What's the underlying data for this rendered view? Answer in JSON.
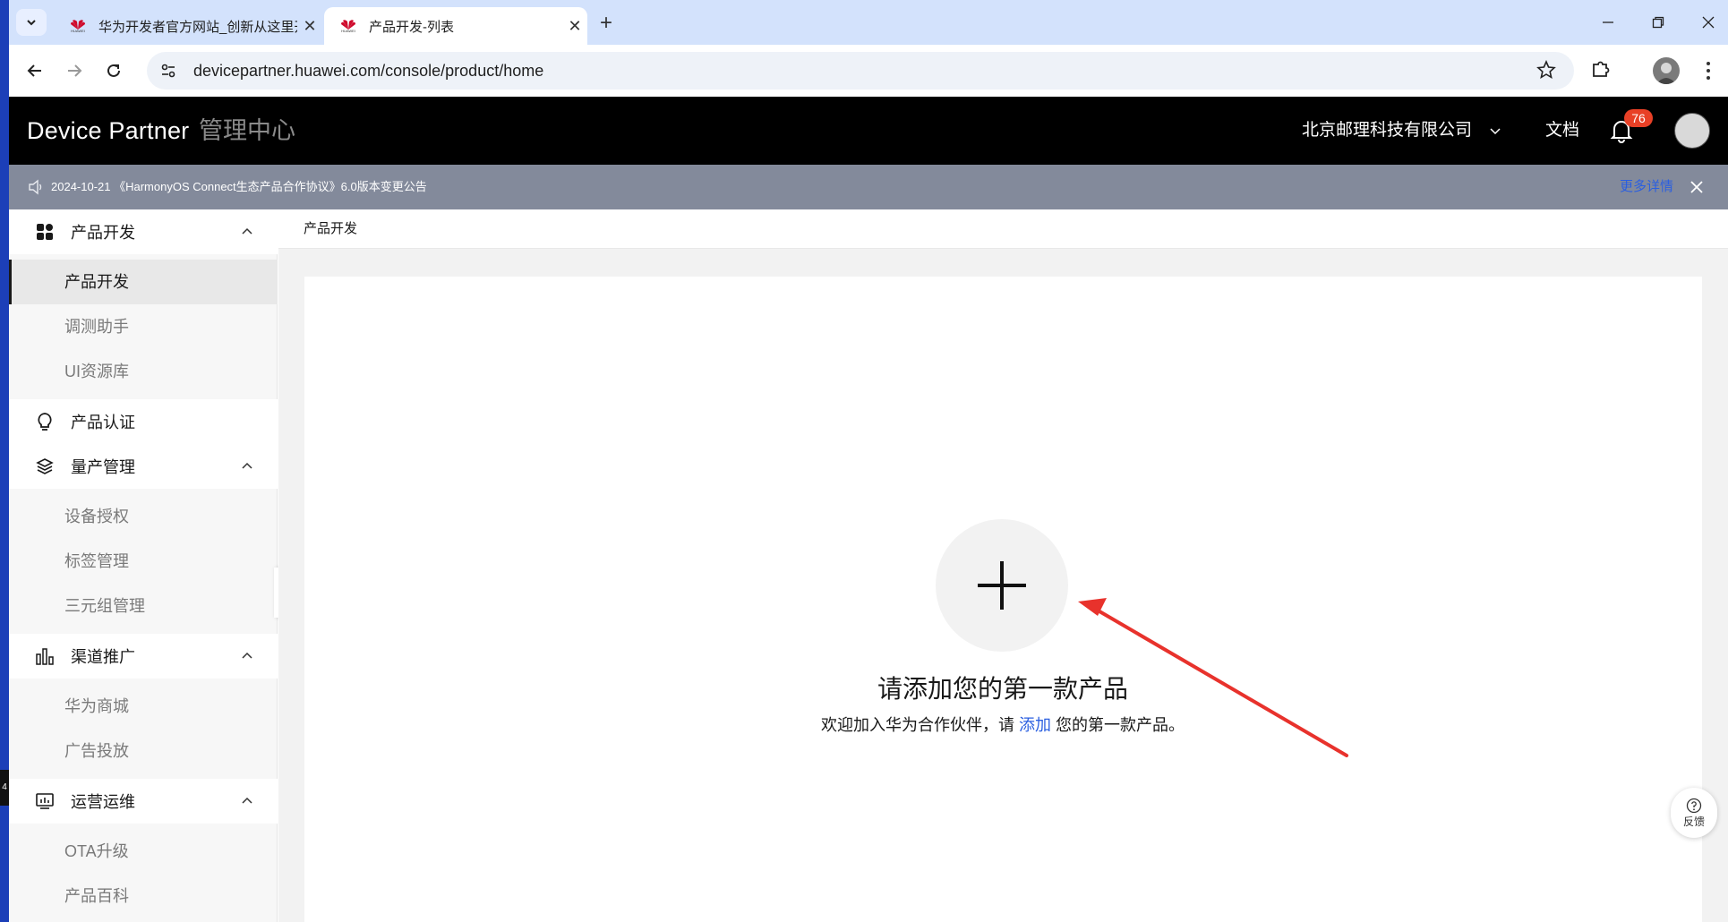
{
  "browser": {
    "tabs": [
      {
        "title": "华为开发者官方网站_创新从这里开始",
        "favicon_text": "HUAWEI"
      },
      {
        "title": "产品开发-列表",
        "favicon_text": "HUAWEI"
      }
    ],
    "url": "devicepartner.huawei.com/console/product/home"
  },
  "header": {
    "brand": "Device Partner",
    "center": "管理中心",
    "company": "北京邮理科技有限公司",
    "docs": "文档",
    "notification_count": "76"
  },
  "notice": {
    "text": "2024-10-21 《HarmonyOS Connect生态产品合作协议》6.0版本变更公告",
    "more_link": "更多详情"
  },
  "sidebar": {
    "groups": [
      {
        "label": "产品开发",
        "icon": "grid-icon",
        "items": [
          "产品开发",
          "调测助手",
          "UI资源库"
        ]
      },
      {
        "label": "产品认证",
        "icon": "lightbulb-icon",
        "items": []
      },
      {
        "label": "量产管理",
        "icon": "layers-icon",
        "items": [
          "设备授权",
          "标签管理",
          "三元组管理"
        ]
      },
      {
        "label": "渠道推广",
        "icon": "bar-chart-icon",
        "items": [
          "华为商城",
          "广告投放"
        ]
      },
      {
        "label": "运营运维",
        "icon": "monitor-icon",
        "items": [
          "OTA升级",
          "产品百科"
        ]
      }
    ]
  },
  "breadcrumb": "产品开发",
  "empty_state": {
    "title": "请添加您的第一款产品",
    "desc_before": "欢迎加入华为合作伙伴，请 ",
    "link": "添加",
    "desc_after": " 您的第一款产品。"
  },
  "feedback": "反馈",
  "left_strip_mark": "4",
  "colors": {
    "accent": "#2b5fe0",
    "header_bg": "#000000",
    "notice_bg": "#838a9b",
    "badge": "#e84026",
    "arrow": "#e8322c"
  }
}
